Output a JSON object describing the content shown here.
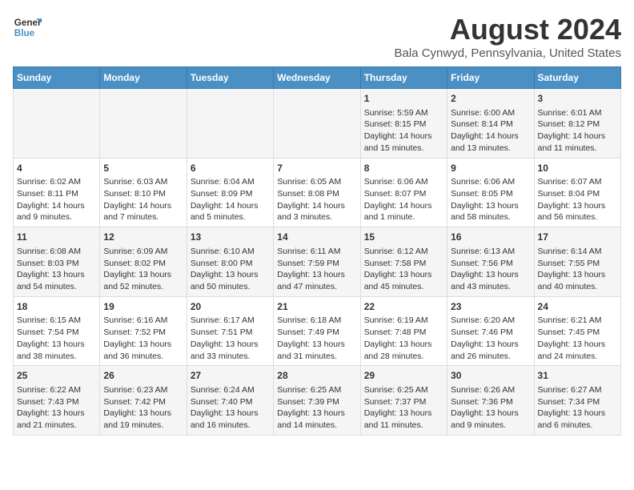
{
  "header": {
    "logo_line1": "General",
    "logo_line2": "Blue",
    "title": "August 2024",
    "subtitle": "Bala Cynwyd, Pennsylvania, United States"
  },
  "weekdays": [
    "Sunday",
    "Monday",
    "Tuesday",
    "Wednesday",
    "Thursday",
    "Friday",
    "Saturday"
  ],
  "weeks": [
    [
      {
        "day": "",
        "content": ""
      },
      {
        "day": "",
        "content": ""
      },
      {
        "day": "",
        "content": ""
      },
      {
        "day": "",
        "content": ""
      },
      {
        "day": "1",
        "content": "Sunrise: 5:59 AM\nSunset: 8:15 PM\nDaylight: 14 hours\nand 15 minutes."
      },
      {
        "day": "2",
        "content": "Sunrise: 6:00 AM\nSunset: 8:14 PM\nDaylight: 14 hours\nand 13 minutes."
      },
      {
        "day": "3",
        "content": "Sunrise: 6:01 AM\nSunset: 8:12 PM\nDaylight: 14 hours\nand 11 minutes."
      }
    ],
    [
      {
        "day": "4",
        "content": "Sunrise: 6:02 AM\nSunset: 8:11 PM\nDaylight: 14 hours\nand 9 minutes."
      },
      {
        "day": "5",
        "content": "Sunrise: 6:03 AM\nSunset: 8:10 PM\nDaylight: 14 hours\nand 7 minutes."
      },
      {
        "day": "6",
        "content": "Sunrise: 6:04 AM\nSunset: 8:09 PM\nDaylight: 14 hours\nand 5 minutes."
      },
      {
        "day": "7",
        "content": "Sunrise: 6:05 AM\nSunset: 8:08 PM\nDaylight: 14 hours\nand 3 minutes."
      },
      {
        "day": "8",
        "content": "Sunrise: 6:06 AM\nSunset: 8:07 PM\nDaylight: 14 hours\nand 1 minute."
      },
      {
        "day": "9",
        "content": "Sunrise: 6:06 AM\nSunset: 8:05 PM\nDaylight: 13 hours\nand 58 minutes."
      },
      {
        "day": "10",
        "content": "Sunrise: 6:07 AM\nSunset: 8:04 PM\nDaylight: 13 hours\nand 56 minutes."
      }
    ],
    [
      {
        "day": "11",
        "content": "Sunrise: 6:08 AM\nSunset: 8:03 PM\nDaylight: 13 hours\nand 54 minutes."
      },
      {
        "day": "12",
        "content": "Sunrise: 6:09 AM\nSunset: 8:02 PM\nDaylight: 13 hours\nand 52 minutes."
      },
      {
        "day": "13",
        "content": "Sunrise: 6:10 AM\nSunset: 8:00 PM\nDaylight: 13 hours\nand 50 minutes."
      },
      {
        "day": "14",
        "content": "Sunrise: 6:11 AM\nSunset: 7:59 PM\nDaylight: 13 hours\nand 47 minutes."
      },
      {
        "day": "15",
        "content": "Sunrise: 6:12 AM\nSunset: 7:58 PM\nDaylight: 13 hours\nand 45 minutes."
      },
      {
        "day": "16",
        "content": "Sunrise: 6:13 AM\nSunset: 7:56 PM\nDaylight: 13 hours\nand 43 minutes."
      },
      {
        "day": "17",
        "content": "Sunrise: 6:14 AM\nSunset: 7:55 PM\nDaylight: 13 hours\nand 40 minutes."
      }
    ],
    [
      {
        "day": "18",
        "content": "Sunrise: 6:15 AM\nSunset: 7:54 PM\nDaylight: 13 hours\nand 38 minutes."
      },
      {
        "day": "19",
        "content": "Sunrise: 6:16 AM\nSunset: 7:52 PM\nDaylight: 13 hours\nand 36 minutes."
      },
      {
        "day": "20",
        "content": "Sunrise: 6:17 AM\nSunset: 7:51 PM\nDaylight: 13 hours\nand 33 minutes."
      },
      {
        "day": "21",
        "content": "Sunrise: 6:18 AM\nSunset: 7:49 PM\nDaylight: 13 hours\nand 31 minutes."
      },
      {
        "day": "22",
        "content": "Sunrise: 6:19 AM\nSunset: 7:48 PM\nDaylight: 13 hours\nand 28 minutes."
      },
      {
        "day": "23",
        "content": "Sunrise: 6:20 AM\nSunset: 7:46 PM\nDaylight: 13 hours\nand 26 minutes."
      },
      {
        "day": "24",
        "content": "Sunrise: 6:21 AM\nSunset: 7:45 PM\nDaylight: 13 hours\nand 24 minutes."
      }
    ],
    [
      {
        "day": "25",
        "content": "Sunrise: 6:22 AM\nSunset: 7:43 PM\nDaylight: 13 hours\nand 21 minutes."
      },
      {
        "day": "26",
        "content": "Sunrise: 6:23 AM\nSunset: 7:42 PM\nDaylight: 13 hours\nand 19 minutes."
      },
      {
        "day": "27",
        "content": "Sunrise: 6:24 AM\nSunset: 7:40 PM\nDaylight: 13 hours\nand 16 minutes."
      },
      {
        "day": "28",
        "content": "Sunrise: 6:25 AM\nSunset: 7:39 PM\nDaylight: 13 hours\nand 14 minutes."
      },
      {
        "day": "29",
        "content": "Sunrise: 6:25 AM\nSunset: 7:37 PM\nDaylight: 13 hours\nand 11 minutes."
      },
      {
        "day": "30",
        "content": "Sunrise: 6:26 AM\nSunset: 7:36 PM\nDaylight: 13 hours\nand 9 minutes."
      },
      {
        "day": "31",
        "content": "Sunrise: 6:27 AM\nSunset: 7:34 PM\nDaylight: 13 hours\nand 6 minutes."
      }
    ]
  ]
}
